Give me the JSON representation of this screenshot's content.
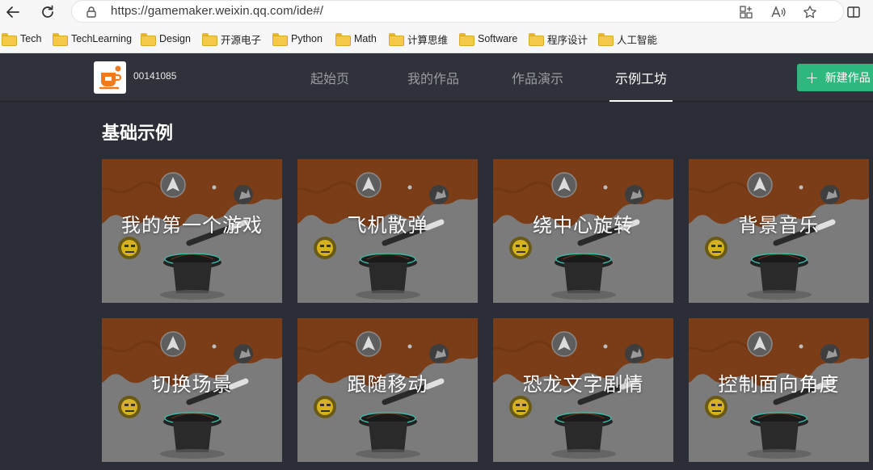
{
  "browser": {
    "url": "https://gamemaker.weixin.qq.com/ide#/",
    "bookmarks": [
      {
        "label": "Tech"
      },
      {
        "label": "TechLearning"
      },
      {
        "label": "Design"
      },
      {
        "label": "开源电子"
      },
      {
        "label": "Python"
      },
      {
        "label": "Math"
      },
      {
        "label": "计算思维"
      },
      {
        "label": "Software"
      },
      {
        "label": "程序设计"
      },
      {
        "label": "人工智能"
      }
    ]
  },
  "header": {
    "user_id": "00141085",
    "tabs": [
      {
        "label": "起始页",
        "active": false
      },
      {
        "label": "我的作品",
        "active": false
      },
      {
        "label": "作品演示",
        "active": false
      },
      {
        "label": "示例工坊",
        "active": true
      }
    ],
    "new_button_label": "新建作品",
    "accent_color": "#2eb87d"
  },
  "main": {
    "section_title": "基础示例",
    "cards": [
      {
        "title": "我的第一个游戏"
      },
      {
        "title": "飞机散弹"
      },
      {
        "title": "绕中心旋转"
      },
      {
        "title": "背景音乐"
      },
      {
        "title": "切换场景"
      },
      {
        "title": "跟随移动"
      },
      {
        "title": "恐龙文字剧情"
      },
      {
        "title": "控制面向角度"
      }
    ]
  },
  "icons": {
    "back": "back-arrow-icon",
    "refresh": "refresh-icon",
    "lock": "lock-icon",
    "extensions": "extensions-icon",
    "read_aloud": "read-aloud-icon",
    "favorite": "star-icon",
    "split": "split-screen-icon"
  }
}
